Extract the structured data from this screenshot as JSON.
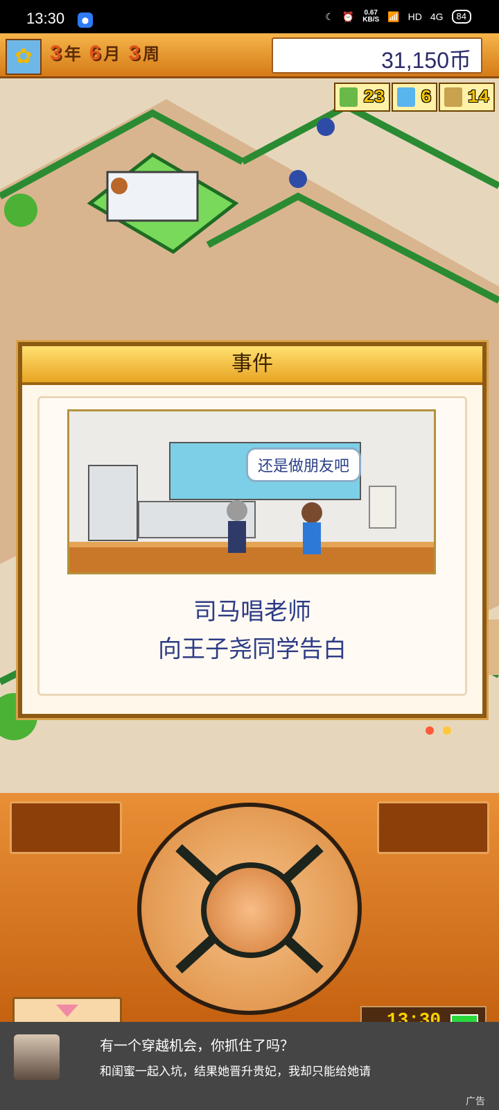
{
  "statusbar": {
    "time": "13:30",
    "network_speed_value": "0.67",
    "network_speed_unit": "KB/S",
    "connection": "HD",
    "signal": "4G",
    "battery": "84"
  },
  "game": {
    "date": {
      "year": "3",
      "year_unit": "年",
      "month": "6",
      "month_unit": "月",
      "week": "3",
      "week_unit": "周"
    },
    "money": "31,150币",
    "stats": [
      {
        "icon": "pencil-icon",
        "value": "23"
      },
      {
        "icon": "flask-icon",
        "value": "6"
      },
      {
        "icon": "trophy-icon",
        "value": "14"
      }
    ],
    "event_dialog": {
      "title": "事件",
      "speech": "还是做朋友吧",
      "line1": "司马唱老师",
      "line2": "向王子尧同学告白"
    },
    "clock": "13:30"
  },
  "ad": {
    "title": "有一个穿越机会，你抓住了吗？",
    "description": "和闺蜜一起入坑，结果她晋升贵妃，我却只能给她请",
    "tag": "广告"
  }
}
